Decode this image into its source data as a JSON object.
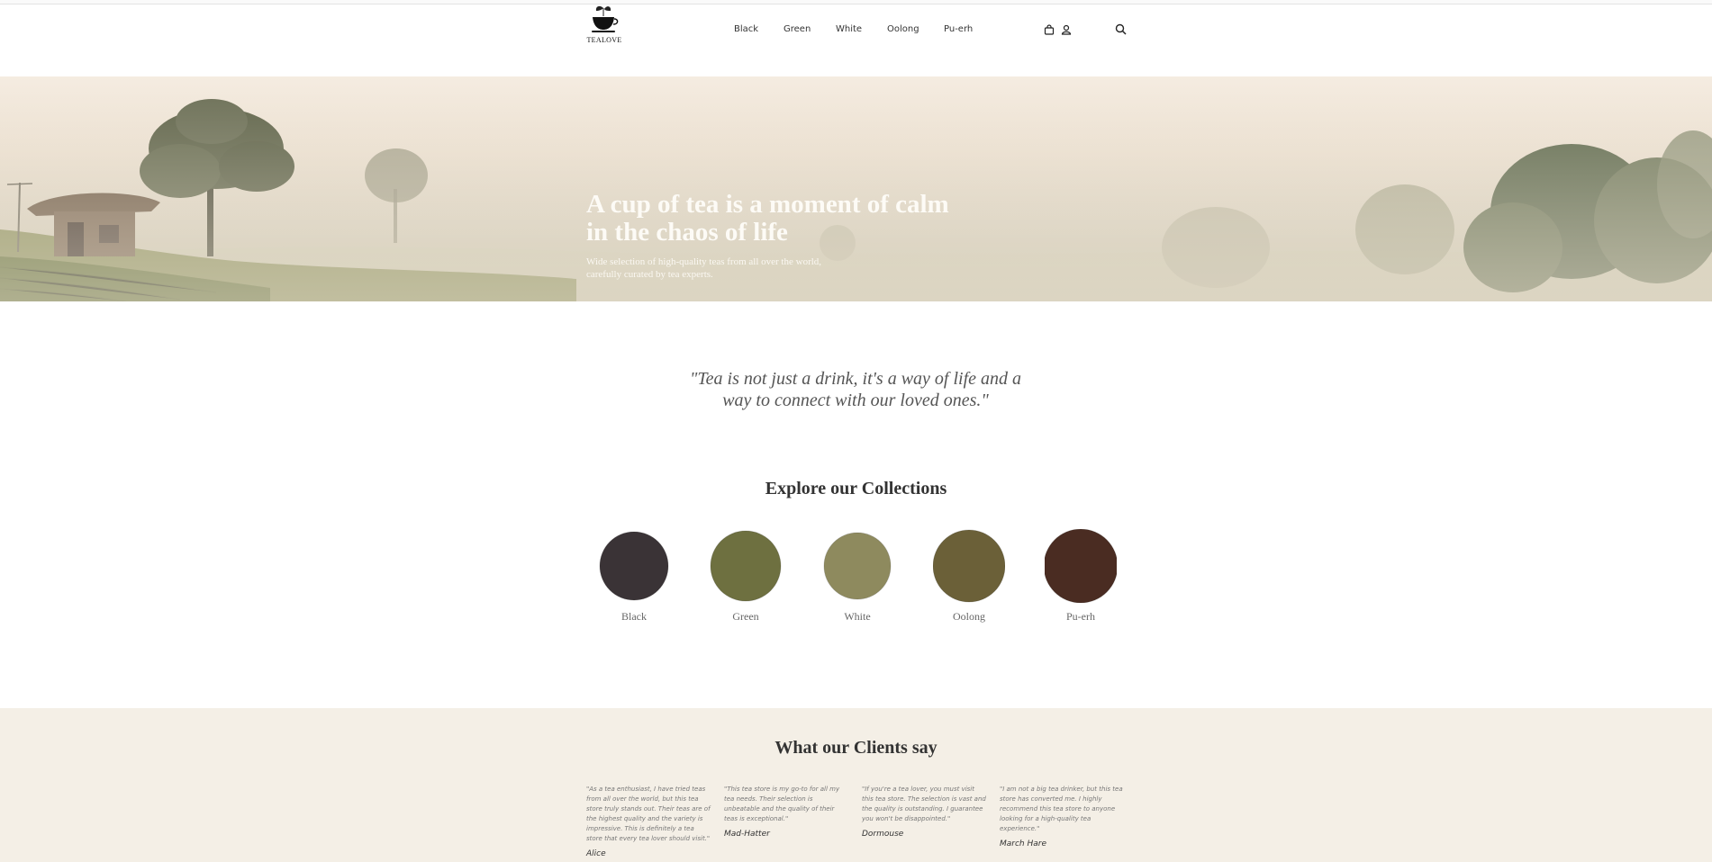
{
  "brand": {
    "name": "TEALOVE"
  },
  "nav": {
    "items": [
      "Black",
      "Green",
      "White",
      "Oolong",
      "Pu-erh"
    ]
  },
  "header_icons": [
    "bag-icon",
    "user-icon",
    "search-icon"
  ],
  "hero": {
    "title_line1": "A cup of tea is a moment of calm",
    "title_line2": "in the chaos of life",
    "subtitle_line1": "Wide selection of high-quality teas from all over the world,",
    "subtitle_line2": "carefully curated by tea experts."
  },
  "quote": {
    "line1": "\"Tea is not just a drink, it's a way of life and a",
    "line2": "way to connect with our loved ones.\""
  },
  "collections": {
    "title": "Explore our Collections",
    "items": [
      {
        "label": "Black",
        "color": "#3a3336"
      },
      {
        "label": "Green",
        "color": "#6e7040"
      },
      {
        "label": "White",
        "color": "#8e8a5e"
      },
      {
        "label": "Oolong",
        "color": "#6b6038"
      },
      {
        "label": "Pu-erh",
        "color": "#4a2c22"
      }
    ]
  },
  "clients": {
    "title": "What our Clients say",
    "testimonials": [
      {
        "text": "\"As a tea enthusiast, I have tried teas from all over the world, but this tea store truly stands out. Their teas are of the highest quality and the variety is impressive. This is definitely a tea store that every tea lover should visit.\"",
        "name": "Alice"
      },
      {
        "text": "\"This tea store is my go-to for all my tea needs. Their selection is unbeatable and the quality of their teas is exceptional.\"",
        "name": "Mad-Hatter"
      },
      {
        "text": "\"If you're a tea lover, you must visit this tea store. The selection is vast and the quality is outstanding. I guarantee you won't be disappointed.\"",
        "name": "Dormouse"
      },
      {
        "text": "\"I am not a big tea drinker, but this tea store has converted me. I highly recommend this tea store to anyone looking for a high-quality tea experience.\"",
        "name": "March Hare"
      }
    ]
  },
  "colors": {
    "clients_bg": "#f4efe6",
    "hero_text": "#fdfbf6"
  }
}
